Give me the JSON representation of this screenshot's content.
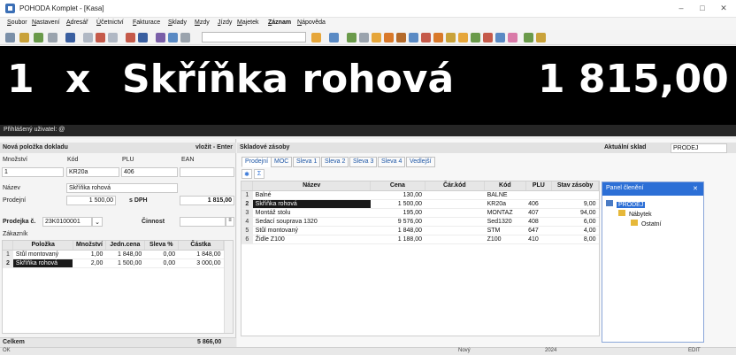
{
  "window": {
    "title": "POHODA Komplet - [Kasa]",
    "minimize": "–",
    "maximize": "□",
    "close": "✕"
  },
  "menu": [
    "Soubor",
    "Nastavení",
    "Adresář",
    "Účetnictví",
    "Fakturace",
    "Sklady",
    "Mzdy",
    "Jízdy",
    "Majetek",
    "Záznam",
    "Nápověda"
  ],
  "display": {
    "quantity": "1",
    "times": "x",
    "item": "Skříňka rohová",
    "amount": "1 815,00"
  },
  "user_strip": "Přihlášený uživatel: @",
  "new_item": {
    "header": "Nová položka dokladu",
    "insert_hint": "vložit - Enter",
    "labels": {
      "quantity": "Množství",
      "code": "Kód",
      "plu": "PLU",
      "ean": "EAN",
      "name": "Název",
      "sale": "Prodejní",
      "with_vat": "s DPH"
    },
    "values": {
      "quantity": "1",
      "code": "KR20a",
      "plu": "406",
      "ean": "",
      "name": "Skříňka rohová",
      "sale": "1 500,00",
      "total": "1 815,00"
    }
  },
  "receipt": {
    "label": "Prodejka č.",
    "number": "23K0100001",
    "activity_label": "Činnost",
    "activity_value": "",
    "customer_label": "Zákazník",
    "columns": [
      "Položka",
      "Množství",
      "Jedn.cena",
      "Sleva %",
      "Částka"
    ],
    "rows": [
      {
        "n": "1",
        "item": "Stůl montovaný",
        "qty": "1,00",
        "price": "1 848,00",
        "disc": "0,00",
        "amount": "1 848,00"
      },
      {
        "n": "2",
        "item": "Skříňka rohová",
        "qty": "2,00",
        "price": "1 500,00",
        "disc": "0,00",
        "amount": "3 000,00"
      }
    ],
    "total_label": "Celkem",
    "total_value": "5 866,00"
  },
  "stock": {
    "header": "Skladové zásoby",
    "warehouse_label": "Aktuální sklad",
    "warehouse_value": "PRODEJ",
    "tabs": [
      "Prodejní",
      "MOC",
      "Sleva 1",
      "Sleva 2",
      "Sleva 3",
      "Sleva 4",
      "Vedlejší"
    ],
    "filter_star": "✱",
    "filter_sigma": "Σ",
    "columns": [
      "Název",
      "Cena",
      "Čár.kód",
      "Kód",
      "PLU",
      "Stav zásoby"
    ],
    "rows": [
      {
        "n": "1",
        "name": "Balné",
        "price": "130,00",
        "barcode": "",
        "code": "BALNE",
        "plu": "",
        "stock": ""
      },
      {
        "n": "2",
        "name": "Skříňka rohová",
        "price": "1 500,00",
        "barcode": "",
        "code": "KR20a",
        "plu": "406",
        "stock": "9,00"
      },
      {
        "n": "3",
        "name": "Montáž stolu",
        "price": "195,00",
        "barcode": "",
        "code": "MONTAZ",
        "plu": "407",
        "stock": "94,00"
      },
      {
        "n": "4",
        "name": "Sedací souprava 1320",
        "price": "9 576,00",
        "barcode": "",
        "code": "Sed1320",
        "plu": "408",
        "stock": "6,00"
      },
      {
        "n": "5",
        "name": "Stůl montovaný",
        "price": "1 848,00",
        "barcode": "",
        "code": "STM",
        "plu": "647",
        "stock": "4,00"
      },
      {
        "n": "6",
        "name": "Židle Z100",
        "price": "1 188,00",
        "barcode": "",
        "code": "Z100",
        "plu": "410",
        "stock": "8,00"
      }
    ]
  },
  "panel": {
    "title": "Panel členění",
    "close": "✕",
    "tree": [
      "PRODEJ",
      "Nábytek",
      "Ostatní"
    ]
  },
  "status": {
    "left": "OK",
    "mode": "Nový",
    "year": "2024",
    "edit": "EDIT"
  }
}
